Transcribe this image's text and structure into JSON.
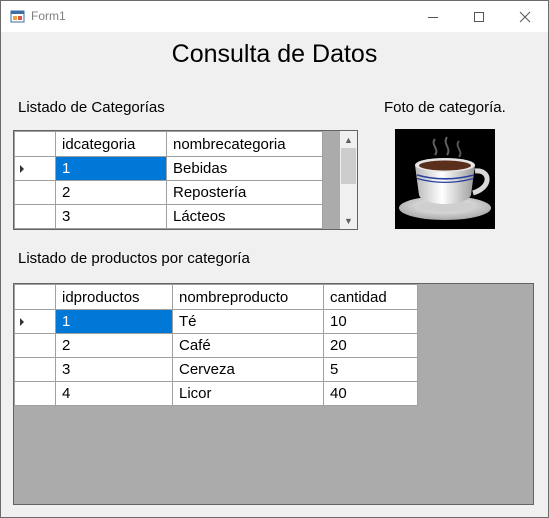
{
  "window": {
    "title": "Form1"
  },
  "heading": "Consulta de Datos",
  "categories": {
    "label": "Listado de Categorías",
    "columns": [
      "idcategoria",
      "nombrecategoria"
    ],
    "rows": [
      [
        "1",
        "Bebidas"
      ],
      [
        "2",
        "Repostería"
      ],
      [
        "3",
        "Lácteos"
      ]
    ],
    "selected_row": 0
  },
  "photo": {
    "label": "Foto de categoría.",
    "icon": "coffee-cup-icon"
  },
  "products": {
    "label": "Listado de productos por categoría",
    "columns": [
      "idproductos",
      "nombreproducto",
      "cantidad"
    ],
    "rows": [
      [
        "1",
        "Té",
        "10"
      ],
      [
        "2",
        "Café",
        "20"
      ],
      [
        "3",
        "Cerveza",
        "5"
      ],
      [
        "4",
        "Licor",
        "40"
      ]
    ],
    "selected_row": 0
  },
  "colors": {
    "selection": "#0078d7",
    "grid_background": "#ababab",
    "window_background": "#f0f0f0"
  }
}
